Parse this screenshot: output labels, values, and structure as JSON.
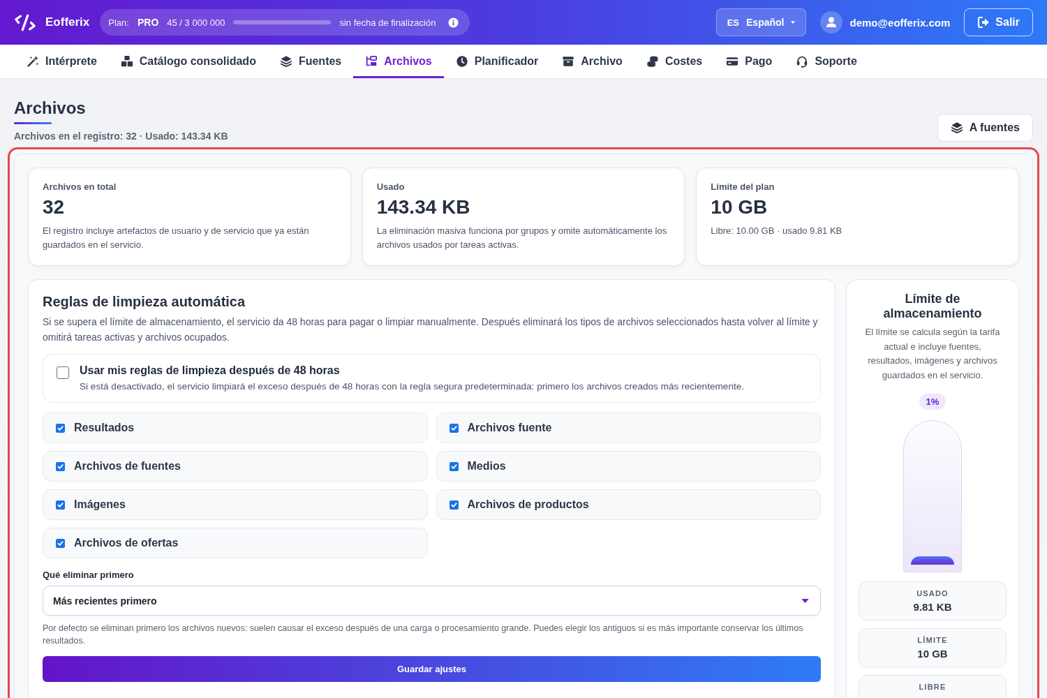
{
  "header": {
    "brand": "Eofferix",
    "plan": {
      "label": "Plan:",
      "name": "PRO",
      "usage": "45 / 3 000 000",
      "expiry": "sin fecha de finalización"
    },
    "language": {
      "code": "ES",
      "name": "Español"
    },
    "user": "demo@eofferix.com",
    "logout": "Salir"
  },
  "nav": [
    {
      "label": "Intérprete",
      "selected": false
    },
    {
      "label": "Catálogo consolidado",
      "selected": false
    },
    {
      "label": "Fuentes",
      "selected": false
    },
    {
      "label": "Archivos",
      "selected": true
    },
    {
      "label": "Planificador",
      "selected": false
    },
    {
      "label": "Archivo",
      "selected": false
    },
    {
      "label": "Costes",
      "selected": false
    },
    {
      "label": "Pago",
      "selected": false
    },
    {
      "label": "Soporte",
      "selected": false
    }
  ],
  "page": {
    "title": "Archivos",
    "subtitle": "Archivos en el registro: 32 · Usado: 143.34 KB",
    "action": "A fuentes"
  },
  "stats": [
    {
      "label": "Archivos en total",
      "value": "32",
      "description": "El registro incluye artefactos de usuario y de servicio que ya están guardados en el servicio."
    },
    {
      "label": "Usado",
      "value": "143.34 KB",
      "description": "La eliminación masiva funciona por grupos y omite automáticamente los archivos usados por tareas activas."
    },
    {
      "label": "Límite del plan",
      "value": "10 GB",
      "description": "Libre: 10.00 GB · usado 9.81 KB"
    }
  ],
  "cleanup": {
    "title": "Reglas de limpieza automática",
    "description": "Si se supera el límite de almacenamiento, el servicio da 48 horas para pagar o limpiar manualmente. Después eliminará los tipos de archivos seleccionados hasta volver al límite y omitirá tareas activas y archivos ocupados.",
    "toggle": {
      "checked": false,
      "title": "Usar mis reglas de limpieza después de 48 horas",
      "description": "Si está desactivado, el servicio limpiará el exceso después de 48 horas con la regla segura predeterminada: primero los archivos creados más recientemente."
    },
    "categories": [
      {
        "label": "Resultados",
        "checked": true
      },
      {
        "label": "Archivos fuente",
        "checked": true
      },
      {
        "label": "Archivos de fuentes",
        "checked": true
      },
      {
        "label": "Medios",
        "checked": true
      },
      {
        "label": "Imágenes",
        "checked": true
      },
      {
        "label": "Archivos de productos",
        "checked": true
      },
      {
        "label": "Archivos de ofertas",
        "checked": true
      }
    ],
    "order": {
      "label": "Qué eliminar primero",
      "value": "Más recientes primero"
    },
    "hint": "Por defecto se eliminan primero los archivos nuevos: suelen causar el exceso después de una carga o procesamiento grande. Puedes elegir los antiguos si es más importante conservar los últimos resultados.",
    "save": "Guardar ajustes"
  },
  "storage": {
    "title": "Límite de almacenamiento",
    "description": "El límite se calcula según la tarifa actual e incluye fuentes, resultados, imágenes y archivos guardados en el servicio.",
    "percent": "1%",
    "level": 0.01,
    "stats": [
      {
        "label": "USADO",
        "value": "9.81 KB"
      },
      {
        "label": "LÍMITE",
        "value": "10 GB"
      },
      {
        "label": "LIBRE"
      }
    ]
  }
}
